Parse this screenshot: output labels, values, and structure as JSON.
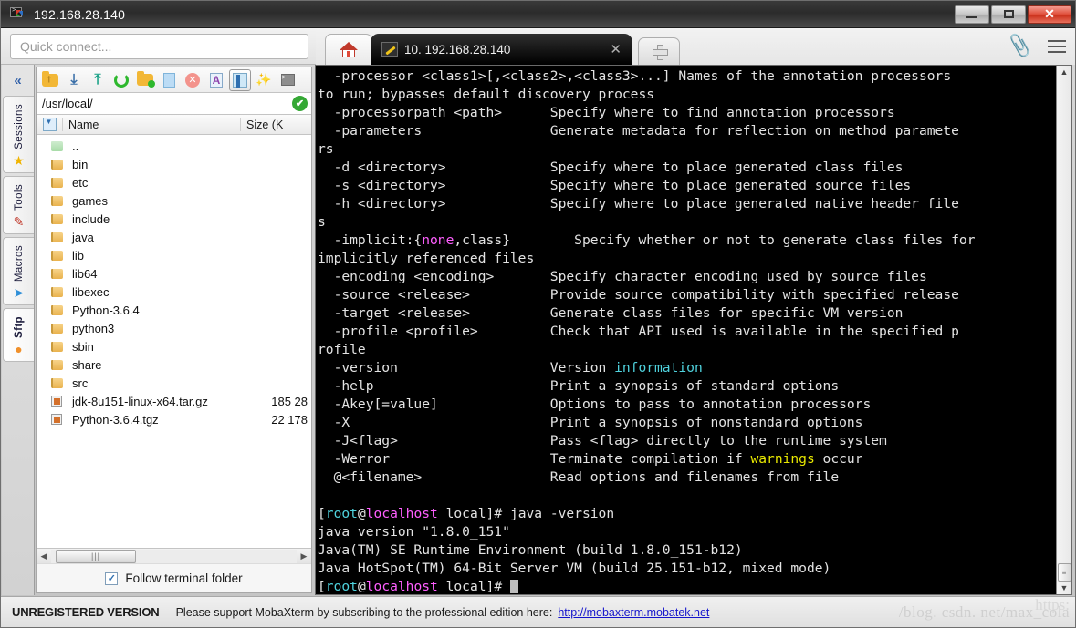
{
  "window": {
    "title": "192.168.28.140",
    "icon": "terminal-color-icon",
    "minimize_label": "",
    "maximize_label": "",
    "close_label": "✕"
  },
  "quick_connect": {
    "placeholder": "Quick connect...",
    "value": ""
  },
  "tabs": {
    "home_icon": "home-icon",
    "session_tab": {
      "icon": "wrench-icon",
      "label": "10. 192.168.28.140",
      "close_label": "✕"
    },
    "new_tab_label": "✛"
  },
  "top_right": {
    "attach_icon": "paperclip-icon",
    "menu_icon": "hamburger-menu-icon"
  },
  "sidebar": {
    "collapse_label": "«",
    "items": [
      {
        "label": "Sessions",
        "icon": "star-icon",
        "glyph": "★",
        "color": "#f0b400",
        "active": false
      },
      {
        "label": "Tools",
        "icon": "tools-icon",
        "glyph": "🖊",
        "color": "#c0392b",
        "active": false
      },
      {
        "label": "Macros",
        "icon": "paper-plane-icon",
        "glyph": "➤",
        "color": "#2f8fd8",
        "active": false
      },
      {
        "label": "Sftp",
        "icon": "globe-icon",
        "glyph": "●",
        "color": "#f0902b",
        "active": true
      }
    ]
  },
  "sftp_panel": {
    "toolbar": [
      {
        "name": "parent-folder-button",
        "icon": "folder-up-icon"
      },
      {
        "name": "download-button",
        "icon": "download-icon"
      },
      {
        "name": "upload-button",
        "icon": "upload-icon"
      },
      {
        "name": "refresh-button",
        "icon": "refresh-icon"
      },
      {
        "name": "new-folder-button",
        "icon": "new-folder-icon"
      },
      {
        "name": "new-file-button",
        "icon": "new-file-icon"
      },
      {
        "name": "delete-button",
        "icon": "delete-icon"
      },
      {
        "name": "edit-file-button",
        "icon": "text-edit-icon"
      },
      {
        "name": "split-view-button",
        "icon": "split-panel-icon"
      },
      {
        "name": "magic-wand-button",
        "icon": "magic-wand-icon"
      },
      {
        "name": "terminal-button",
        "icon": "terminal-icon"
      }
    ],
    "path": "/usr/local/",
    "path_status_icon": "check-circle-icon",
    "path_status_glyph": "✔",
    "columns": {
      "name": "Name",
      "size": "Size (K"
    },
    "files": [
      {
        "name": "..",
        "size": "",
        "type": "parent"
      },
      {
        "name": "bin",
        "size": "",
        "type": "folder"
      },
      {
        "name": "etc",
        "size": "",
        "type": "folder"
      },
      {
        "name": "games",
        "size": "",
        "type": "folder"
      },
      {
        "name": "include",
        "size": "",
        "type": "folder"
      },
      {
        "name": "java",
        "size": "",
        "type": "folder"
      },
      {
        "name": "lib",
        "size": "",
        "type": "folder"
      },
      {
        "name": "lib64",
        "size": "",
        "type": "folder"
      },
      {
        "name": "libexec",
        "size": "",
        "type": "folder"
      },
      {
        "name": "Python-3.6.4",
        "size": "",
        "type": "folder"
      },
      {
        "name": "python3",
        "size": "",
        "type": "folder"
      },
      {
        "name": "sbin",
        "size": "",
        "type": "folder"
      },
      {
        "name": "share",
        "size": "",
        "type": "folder"
      },
      {
        "name": "src",
        "size": "",
        "type": "folder"
      },
      {
        "name": "jdk-8u151-linux-x64.tar.gz",
        "size": "185 28",
        "type": "archive"
      },
      {
        "name": "Python-3.6.4.tgz",
        "size": "22 178",
        "type": "archive"
      }
    ],
    "hscroll": {
      "left_arrow": "◀",
      "right_arrow": "▶",
      "thumb_grip": "|||"
    },
    "follow_terminal": {
      "label": "Follow terminal folder",
      "checked": true,
      "check_glyph": "✓"
    }
  },
  "terminal": {
    "colors": {
      "background": "#000000",
      "foreground": "#e3e3e3",
      "cyan": "#4fd2dd",
      "magenta": "#ff5fff",
      "yellow": "#e8e800"
    },
    "lines": [
      {
        "segments": [
          {
            "t": "  -processor <class1>[,<class2>,<class3>...] Names of the annotation processors"
          }
        ]
      },
      {
        "segments": [
          {
            "t": "to run; bypasses default discovery process"
          }
        ]
      },
      {
        "segments": [
          {
            "t": "  -processorpath <path>      Specify where to find annotation processors"
          }
        ]
      },
      {
        "segments": [
          {
            "t": "  -parameters                Generate metadata for reflection on method paramete"
          }
        ]
      },
      {
        "segments": [
          {
            "t": "rs"
          }
        ]
      },
      {
        "segments": [
          {
            "t": "  -d <directory>             Specify where to place generated class files"
          }
        ]
      },
      {
        "segments": [
          {
            "t": "  -s <directory>             Specify where to place generated source files"
          }
        ]
      },
      {
        "segments": [
          {
            "t": "  -h <directory>             Specify where to place generated native header file"
          }
        ]
      },
      {
        "segments": [
          {
            "t": "s"
          }
        ]
      },
      {
        "segments": [
          {
            "t": "  -implicit:{"
          },
          {
            "t": "none",
            "c": "mag"
          },
          {
            "t": ",class}        Specify whether or not to generate class files for"
          }
        ]
      },
      {
        "segments": [
          {
            "t": "implicitly referenced files"
          }
        ]
      },
      {
        "segments": [
          {
            "t": "  -encoding <encoding>       Specify character encoding used by source files"
          }
        ]
      },
      {
        "segments": [
          {
            "t": "  -source <release>          Provide source compatibility with specified release"
          }
        ]
      },
      {
        "segments": [
          {
            "t": "  -target <release>          Generate class files for specific VM version"
          }
        ]
      },
      {
        "segments": [
          {
            "t": "  -profile <profile>         Check that API used is available in the specified p"
          }
        ]
      },
      {
        "segments": [
          {
            "t": "rofile"
          }
        ]
      },
      {
        "segments": [
          {
            "t": "  -version                   Version "
          },
          {
            "t": "information",
            "c": "cyan"
          }
        ]
      },
      {
        "segments": [
          {
            "t": "  -help                      Print a synopsis of standard options"
          }
        ]
      },
      {
        "segments": [
          {
            "t": "  -Akey[=value]              Options to pass to annotation processors"
          }
        ]
      },
      {
        "segments": [
          {
            "t": "  -X                         Print a synopsis of nonstandard options"
          }
        ]
      },
      {
        "segments": [
          {
            "t": "  -J<flag>                   Pass <flag> directly to the runtime system"
          }
        ]
      },
      {
        "segments": [
          {
            "t": "  -Werror                    Terminate compilation if "
          },
          {
            "t": "warnings",
            "c": "yel"
          },
          {
            "t": " occur"
          }
        ]
      },
      {
        "segments": [
          {
            "t": "  @<filename>                Read options and filenames from file"
          }
        ]
      },
      {
        "segments": [
          {
            "t": ""
          }
        ]
      },
      {
        "segments": [
          {
            "t": "["
          },
          {
            "t": "root",
            "c": "cyan"
          },
          {
            "t": "@"
          },
          {
            "t": "localhost",
            "c": "mag"
          },
          {
            "t": " local]# java -version"
          }
        ]
      },
      {
        "segments": [
          {
            "t": "java version \"1.8.0_151\""
          }
        ]
      },
      {
        "segments": [
          {
            "t": "Java(TM) SE Runtime Environment (build 1.8.0_151-b12)"
          }
        ]
      },
      {
        "segments": [
          {
            "t": "Java HotSpot(TM) 64-Bit Server VM (build 25.151-b12, mixed mode)"
          }
        ]
      },
      {
        "segments": [
          {
            "t": "["
          },
          {
            "t": "root",
            "c": "cyan"
          },
          {
            "t": "@"
          },
          {
            "t": "localhost",
            "c": "mag"
          },
          {
            "t": " local]# "
          },
          {
            "cursor": true
          }
        ]
      }
    ],
    "scrollbar": {
      "up_arrow": "▲",
      "down_arrow": "▼",
      "thumb_grip": "≡"
    }
  },
  "status_bar": {
    "unregistered": "UNREGISTERED VERSION",
    "dash": "-",
    "message": "Please support MobaXterm by subscribing to the professional edition here:",
    "link": "http://mobaxterm.mobatek.net",
    "watermark": "/blog. csdn. net/max_cola",
    "watermark_top": "https:"
  }
}
